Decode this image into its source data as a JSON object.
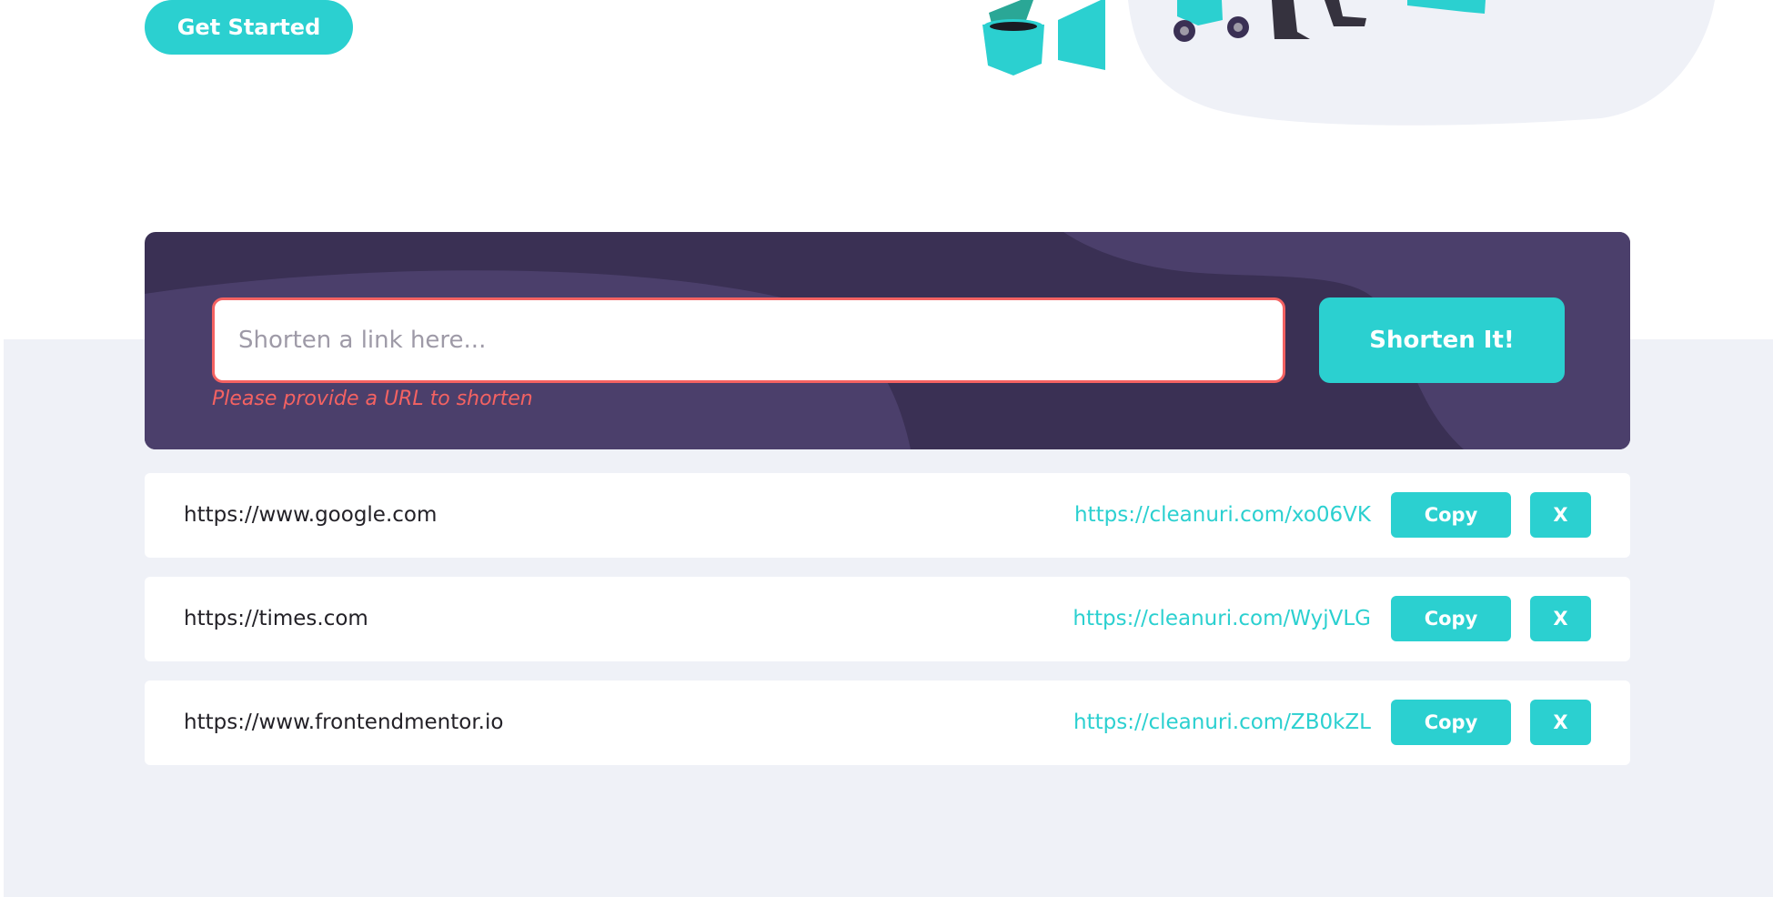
{
  "hero": {
    "cta_label": "Get Started"
  },
  "shortener": {
    "input_placeholder": "Shorten a link here...",
    "input_value": "",
    "submit_label": "Shorten It!",
    "error_message": "Please provide a URL to shorten"
  },
  "results": [
    {
      "original": "https://www.google.com",
      "short": "https://cleanuri.com/xo06VK",
      "copy_label": "Copy",
      "remove_label": "X"
    },
    {
      "original": "https://times.com",
      "short": "https://cleanuri.com/WyjVLG",
      "copy_label": "Copy",
      "remove_label": "X"
    },
    {
      "original": "https://www.frontendmentor.io",
      "short": "https://cleanuri.com/ZB0kZL",
      "copy_label": "Copy",
      "remove_label": "X"
    }
  ],
  "colors": {
    "cyan": "#2bd0d0",
    "dark_violet": "#3a3054",
    "red": "#f46262",
    "light_gray_bg": "#eff1f7"
  },
  "icons": {
    "hero_illustration": "working-person-illustration"
  }
}
